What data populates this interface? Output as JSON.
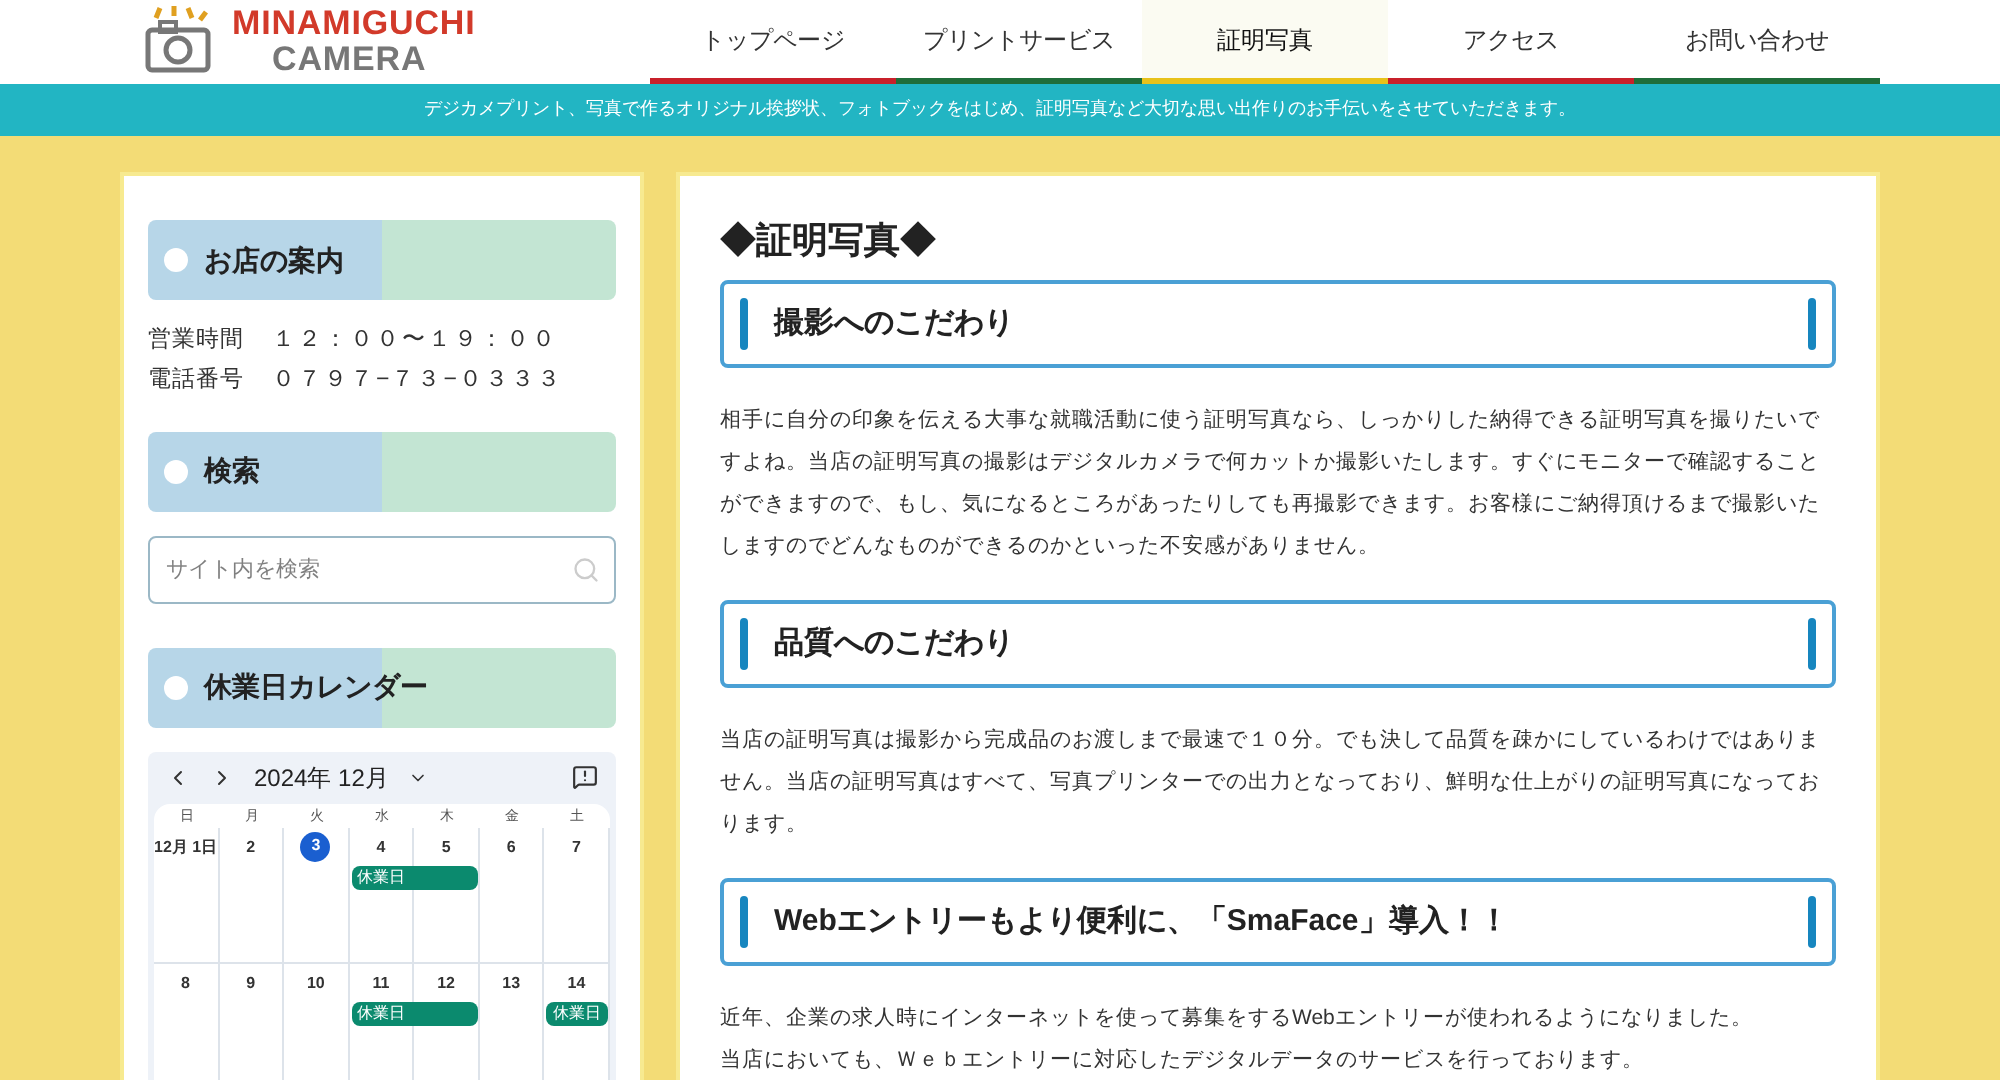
{
  "logo": {
    "top": "MINAMIGUCHI",
    "bottom": "CAMERA"
  },
  "nav": [
    {
      "label": "トップページ",
      "color": "#c8202a",
      "selected": false
    },
    {
      "label": "プリントサービス",
      "color": "#1f6e3a",
      "selected": false
    },
    {
      "label": "証明写真",
      "color": "#e8c21a",
      "selected": true
    },
    {
      "label": "アクセス",
      "color": "#c8202a",
      "selected": false
    },
    {
      "label": "お問い合わせ",
      "color": "#1f6e3a",
      "selected": false
    }
  ],
  "banner": "デジカメプリント、写真で作るオリジナル挨拶状、フォトブックをはじめ、証明写真など大切な思い出作りのお手伝いをさせていただきます。",
  "sidebar": {
    "shop": {
      "title": "お店の案内",
      "rows": [
        {
          "label": "営業時間",
          "value": "１２：００〜１９：００"
        },
        {
          "label": "電話番号",
          "value": "０７９７−７３−０３３３"
        }
      ]
    },
    "search": {
      "title": "検索",
      "placeholder": "サイト内を検索"
    },
    "calendar": {
      "title": "休業日カレンダー",
      "month": "2024年 12月",
      "weekdays": [
        "日",
        "月",
        "火",
        "水",
        "木",
        "金",
        "土"
      ],
      "weeks": [
        [
          {
            "label": "12月 1日",
            "today": false
          },
          {
            "label": "2",
            "today": false
          },
          {
            "label": "3",
            "today": true
          },
          {
            "label": "4",
            "today": false,
            "event": "休業日"
          },
          {
            "label": "5",
            "today": false,
            "continues": true
          },
          {
            "label": "6",
            "today": false
          },
          {
            "label": "7",
            "today": false
          }
        ],
        [
          {
            "label": "8",
            "today": false
          },
          {
            "label": "9",
            "today": false
          },
          {
            "label": "10",
            "today": false
          },
          {
            "label": "11",
            "today": false,
            "event": "休業日"
          },
          {
            "label": "12",
            "today": false,
            "continues": true
          },
          {
            "label": "13",
            "today": false
          },
          {
            "label": "14",
            "today": false,
            "event": "休業日"
          }
        ]
      ]
    }
  },
  "main": {
    "title": "◆証明写真◆",
    "sections": [
      {
        "heading": "撮影へのこだわり",
        "paragraphs": [
          "相手に自分の印象を伝える大事な就職活動に使う証明写真なら、しっかりした納得できる証明写真を撮りたいですよね。当店の証明写真の撮影はデジタルカメラで何カットか撮影いたします。すぐにモニターで確認することができますので、もし、気になるところがあったりしても再撮影できます。お客様にご納得頂けるまで撮影いたしますのでどんなものができるのかといった不安感がありません。"
        ]
      },
      {
        "heading": "品質へのこだわり",
        "paragraphs": [
          "当店の証明写真は撮影から完成品のお渡しまで最速で１０分。でも決して品質を疎かにしているわけではありません。当店の証明写真はすべて、写真プリンターでの出力となっており、鮮明な仕上がりの証明写真になっております。"
        ]
      },
      {
        "heading": "Webエントリーもより便利に、「SmaFace」導入！！",
        "paragraphs": [
          "近年、企業の求人時にインターネットを使って募集をするWebエントリーが使われるようになりました。",
          "当店においても、Ｗｅｂエントリーに対応したデジタルデータのサービスを行っております。"
        ]
      }
    ]
  }
}
